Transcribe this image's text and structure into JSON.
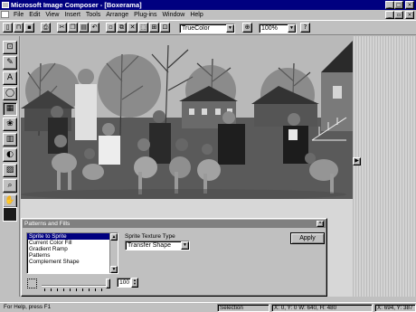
{
  "window": {
    "title": "Microsoft Image Composer - [Boxerama]"
  },
  "menu": [
    "File",
    "Edit",
    "View",
    "Insert",
    "Tools",
    "Arrange",
    "Plug-ins",
    "Window",
    "Help"
  ],
  "toolbar": {
    "color_mode": "TrueColor",
    "zoom": "100%"
  },
  "panel": {
    "title": "Patterns and Fills",
    "fills": [
      "Sprite to Sprite",
      "Current Color Fill",
      "Gradient Ramp",
      "Patterns",
      "Complement Shape"
    ],
    "selected_fill": "Sprite to Sprite",
    "texture_label": "Sprite Texture Type",
    "texture_value": "Transfer Shape",
    "apply_label": "Apply",
    "opacity": "100"
  },
  "status": {
    "help": "For Help, press F1",
    "selection": "Selection",
    "sprite_info": "X: 0, Y: 0 W: 640, H: 480",
    "cursor": "X: 694, Y: 387"
  },
  "colors": {
    "title_bar": "#000080",
    "panel_title_bar": "#808080",
    "chrome": "#c0c0c0",
    "list_selection": "#000080",
    "foreground_color": "#1a1a1a"
  }
}
